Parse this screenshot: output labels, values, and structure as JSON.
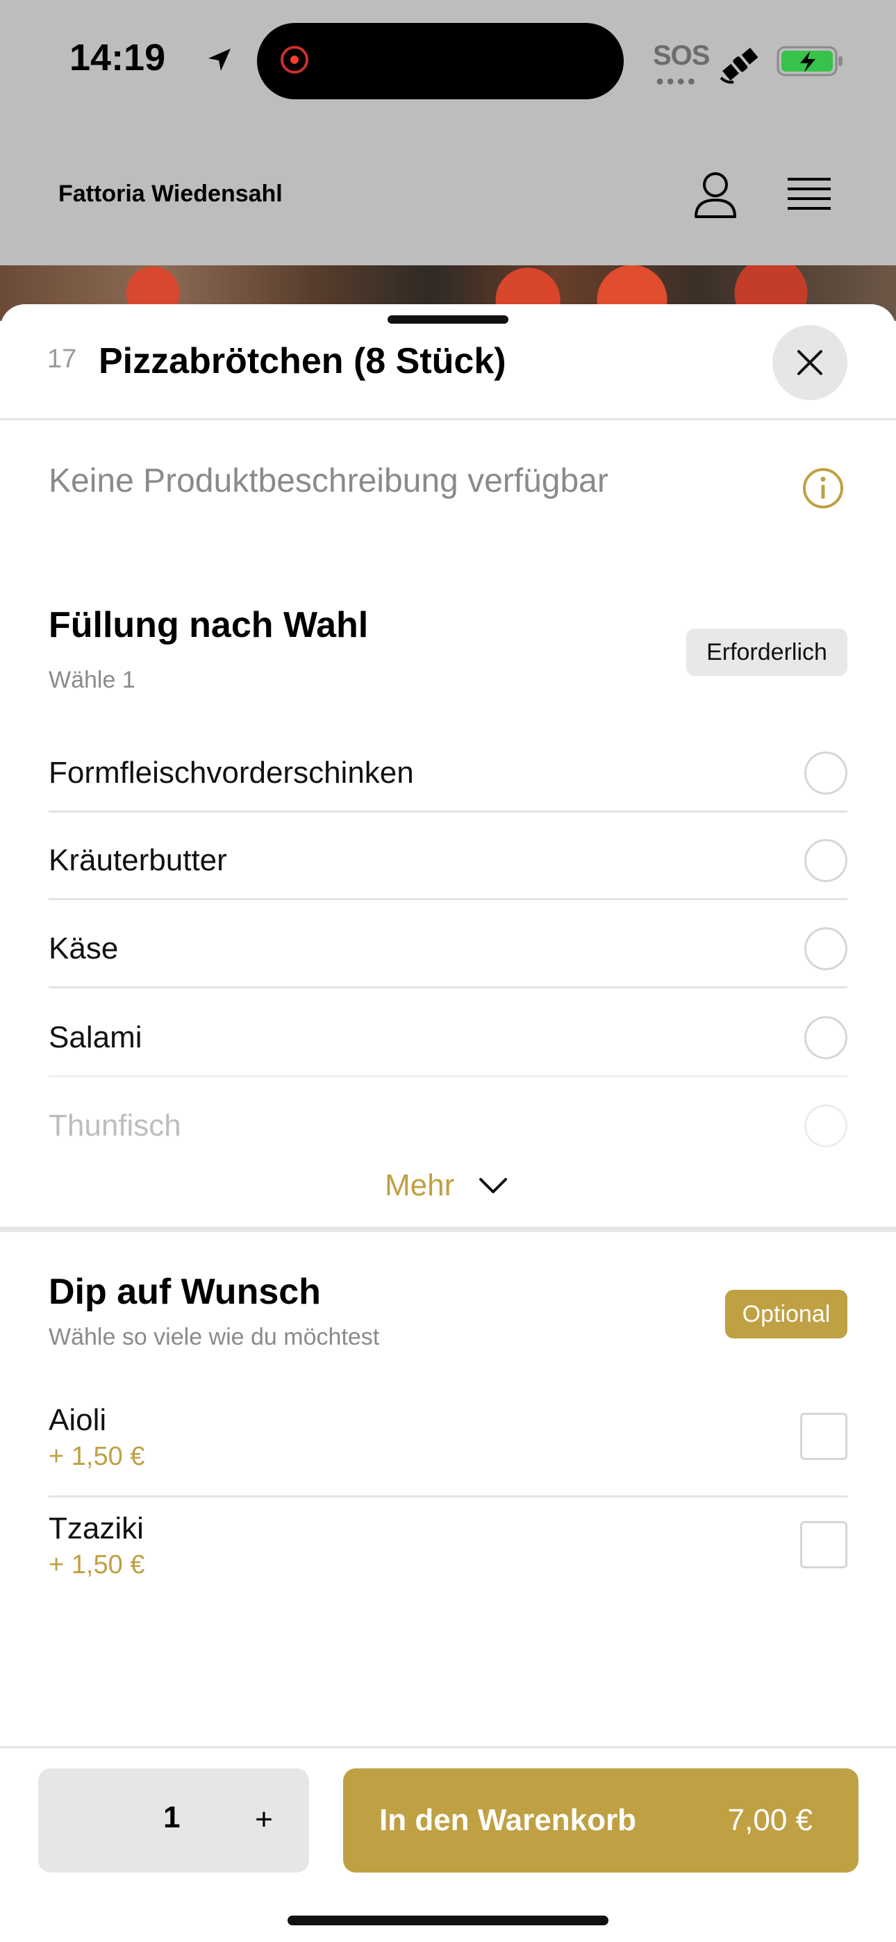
{
  "status_bar": {
    "time": "14:19",
    "sos": "SOS"
  },
  "header": {
    "brand": "Fattoria Wiedensahl"
  },
  "sheet": {
    "item_number": "17",
    "title": "Pizzabrötchen (8 Stück)",
    "description": "Keine Produktbeschreibung verfügbar"
  },
  "group1": {
    "title": "Füllung nach Wahl",
    "subtitle": "Wähle 1",
    "badge": "Erforderlich",
    "options": [
      "Formfleischvorderschinken",
      "Kräuterbutter",
      "Käse",
      "Salami",
      "Thunfisch"
    ],
    "more_label": "Mehr"
  },
  "group2": {
    "title": "Dip auf Wunsch",
    "subtitle": "Wähle so viele wie du möchtest",
    "badge": "Optional",
    "options": [
      {
        "name": "Aioli",
        "price": "+ 1,50 €"
      },
      {
        "name": "Tzaziki",
        "price": "+ 1,50 €"
      }
    ]
  },
  "footer": {
    "quantity": "1",
    "plus_label": "+",
    "cart_label": "In den Warenkorb",
    "cart_price": "7,00 €"
  },
  "colors": {
    "accent": "#bfa043",
    "header_bg": "#bdbdbd",
    "badge_grey": "#e8e8e8"
  }
}
